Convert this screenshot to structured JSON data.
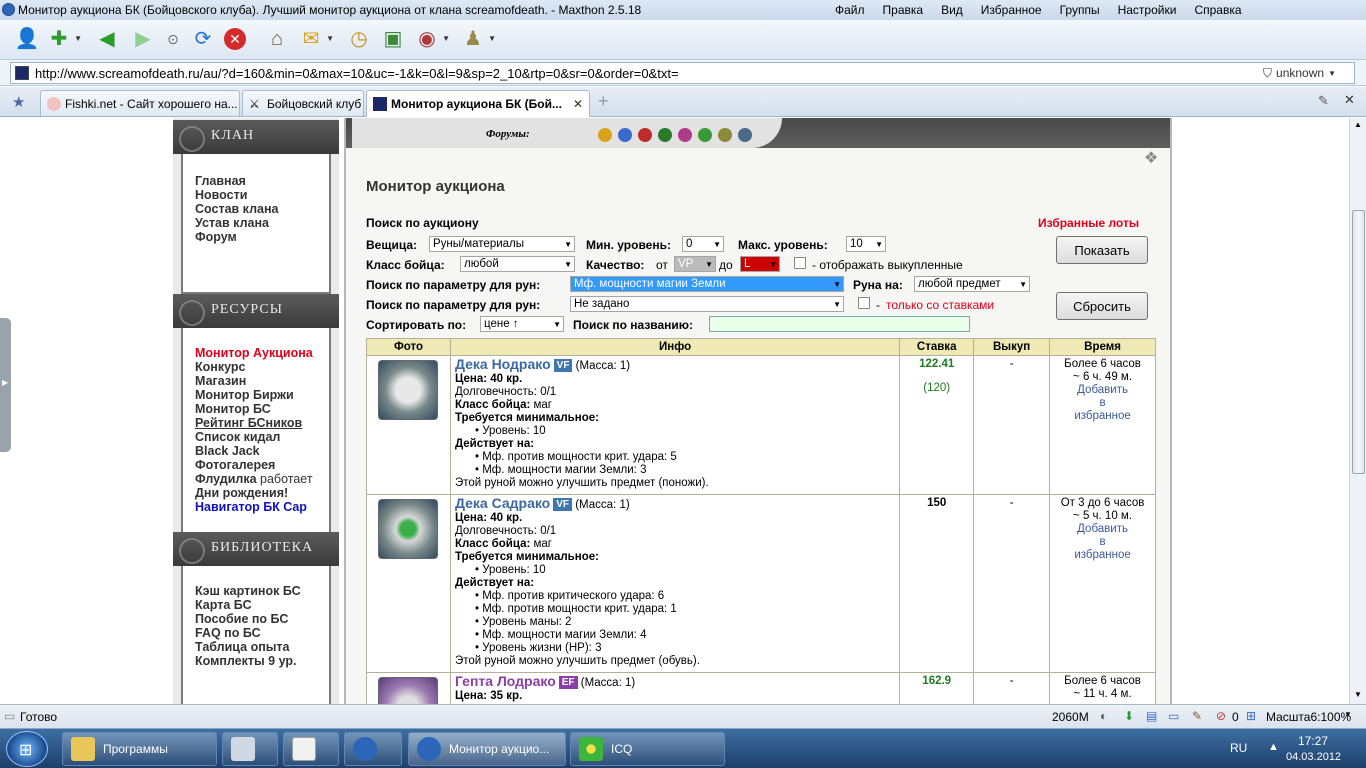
{
  "window": {
    "title": "Монитор аукциона БК (Бойцовского клуба). Лучший монитор аукциона от клана screamofdeath. - Maxthon 2.5.18",
    "menu": [
      "Файл",
      "Правка",
      "Вид",
      "Избранное",
      "Группы",
      "Настройки",
      "Справка"
    ]
  },
  "address": {
    "url": "http://www.screamofdeath.ru/au/?d=160&min=0&max=10&uc=-1&k=0&l=9&sp=2_10&rtp=0&sr=0&order=0&txt=",
    "security": "unknown"
  },
  "tabs": [
    {
      "label": "Fishki.net - Сайт хорошего на..."
    },
    {
      "label": "Бойцовский клуб"
    },
    {
      "label": "Монитор аукциона БК (Бой..."
    }
  ],
  "sidebar": {
    "clan_heading": "КЛАН",
    "clan_links": [
      "Главная",
      "Новости",
      "Состав клана",
      "Устав клана",
      "Форум"
    ],
    "resources_heading": "РЕСУРСЫ",
    "resources_links": [
      "Монитор Аукциона",
      "Конкурс",
      "Магазин",
      "Монитор Биржи",
      "Монитор БС",
      "Рейтинг БСников",
      "Список кидал",
      "Black Jack",
      "Фотогалерея",
      "Флудилка",
      "Дни рождения!",
      "Навигатор БК Cap"
    ],
    "fludilka_status": "работает",
    "library_heading": "БИБЛИОТЕКА",
    "library_links": [
      "Кэш картинок БС",
      "Карта БС",
      "Пособие по БС",
      "FAQ по БС",
      "Таблица опыта",
      "Комплекты 9 ур."
    ]
  },
  "forums": {
    "label": "Форумы:"
  },
  "main": {
    "title": "Монитор аукциона",
    "search_heading": "Поиск по аукциону",
    "favorites_link": "Избранные лоты",
    "labels": {
      "item": "Вещица:",
      "min_level": "Мин. уровень:",
      "max_level": "Макс. уровень:",
      "fighter_class": "Класс бойца:",
      "quality": "Качество:",
      "quality_from": "от",
      "quality_to": "до",
      "show_bought": "- отображать выкупленные",
      "rune_param1": "Поиск по параметру для рун:",
      "rune_on": "Руна на:",
      "rune_param2": "Поиск по параметру для рун:",
      "only_bids_dash": "-",
      "only_bids": "только со ставками",
      "sort": "Сортировать по:",
      "name_search": "Поиск по названию:"
    },
    "values": {
      "item": "Руны/материалы",
      "min_level": "0",
      "max_level": "10",
      "fighter_class": "любой",
      "quality_from": "VP",
      "quality_to": "L",
      "rune_param1": "Мф. мощности магии Земли",
      "rune_on": "любой предмет",
      "rune_param2": "Не задано",
      "sort": "цене ↑",
      "name_search": ""
    },
    "buttons": {
      "show": "Показать",
      "reset": "Сбросить"
    },
    "table": {
      "headers": [
        "Фото",
        "Инфо",
        "Ставка",
        "Выкуп",
        "Время"
      ],
      "rows": [
        {
          "name": "Дека Нодрако",
          "badge": "VF",
          "mass": "(Масса: 1)",
          "price": "Цена: 40 кр.",
          "durability": "Долговечность: 0/1",
          "class_label": "Класс бойца:",
          "class_value": "маг",
          "req_title": "Требуется минимальное:",
          "req": [
            "Уровень: 10"
          ],
          "effects_title": "Действует на:",
          "effects": [
            "Мф. против мощности крит. удара: 5",
            "Мф. мощности магии Земли: 3"
          ],
          "note": "Этой руной можно улучшить предмет (поножи).",
          "bid": "122.41",
          "bid_sub": "(120)",
          "buyout": "-",
          "time": "Более 6 часов",
          "time_left": "~ 6 ч. 49 м.",
          "fav": [
            "Добавить",
            "в",
            "избранное"
          ]
        },
        {
          "name": "Дека Садрако",
          "badge": "VF",
          "mass": "(Масса: 1)",
          "price": "Цена: 40 кр.",
          "durability": "Долговечность: 0/1",
          "class_label": "Класс бойца:",
          "class_value": "маг",
          "req_title": "Требуется минимальное:",
          "req": [
            "Уровень: 10"
          ],
          "effects_title": "Действует на:",
          "effects": [
            "Мф. против критического удара: 6",
            "Мф. против мощности крит. удара: 1",
            "Уровень маны: 2",
            "Мф. мощности магии Земли: 4",
            "Уровень жизни (HP): 3"
          ],
          "note": "Этой руной можно улучшить предмет (обувь).",
          "bid": "150",
          "bid_sub": "",
          "buyout": "-",
          "time": "От 3 до 6 часов",
          "time_left": "~ 5 ч. 10 м.",
          "fav": [
            "Добавить",
            "в",
            "избранное"
          ]
        },
        {
          "name": "Гепта Лодрако",
          "badge": "EF",
          "mass": "(Масса: 1)",
          "price": "Цена: 35 кр.",
          "bid": "162.9",
          "buyout": "-",
          "time": "Более 6 часов",
          "time_left": "~ 11 ч. 4 м."
        }
      ]
    }
  },
  "status": {
    "text": "Готово",
    "memory": "2060M",
    "count": "0",
    "zoom": "Масшта6:100%"
  },
  "taskbar": {
    "programs": "Программы",
    "window": "Монитор аукцио...",
    "icq": "ICQ",
    "lang": "RU",
    "time": "17:27",
    "date": "04.03.2012"
  },
  "colors": {
    "accent_red": "#e0001b",
    "link_blue": "#3c6aa0",
    "header_bg": "#efe9b5"
  }
}
